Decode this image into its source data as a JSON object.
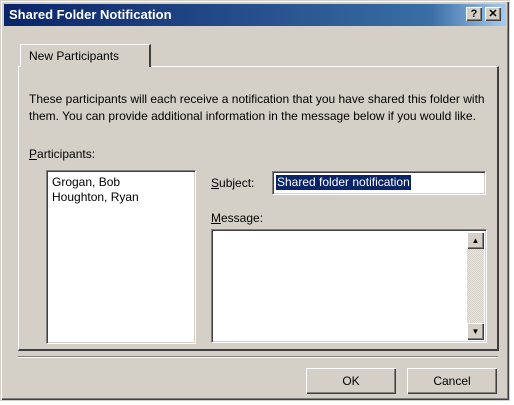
{
  "window": {
    "title": "Shared Folder Notification",
    "help_glyph": "?",
    "close_glyph": "✕"
  },
  "tabs": [
    {
      "label": "New Participants"
    }
  ],
  "description": "These participants will each receive a notification that you have shared this folder with them. You can provide additional information in the message below if you would like.",
  "participants": {
    "label_first": "P",
    "label_rest": "articipants:",
    "items": [
      "Grogan, Bob",
      "Houghton, Ryan"
    ]
  },
  "subject": {
    "label_first": "S",
    "label_rest": "ubject:",
    "value": "Shared folder notification"
  },
  "message": {
    "label_first": "M",
    "label_rest": "essage:",
    "value": ""
  },
  "buttons": {
    "ok": "OK",
    "cancel": "Cancel"
  },
  "colors": {
    "titlebar": "#0a246a",
    "face": "#d4d0c8",
    "selection": "#0a246a"
  }
}
